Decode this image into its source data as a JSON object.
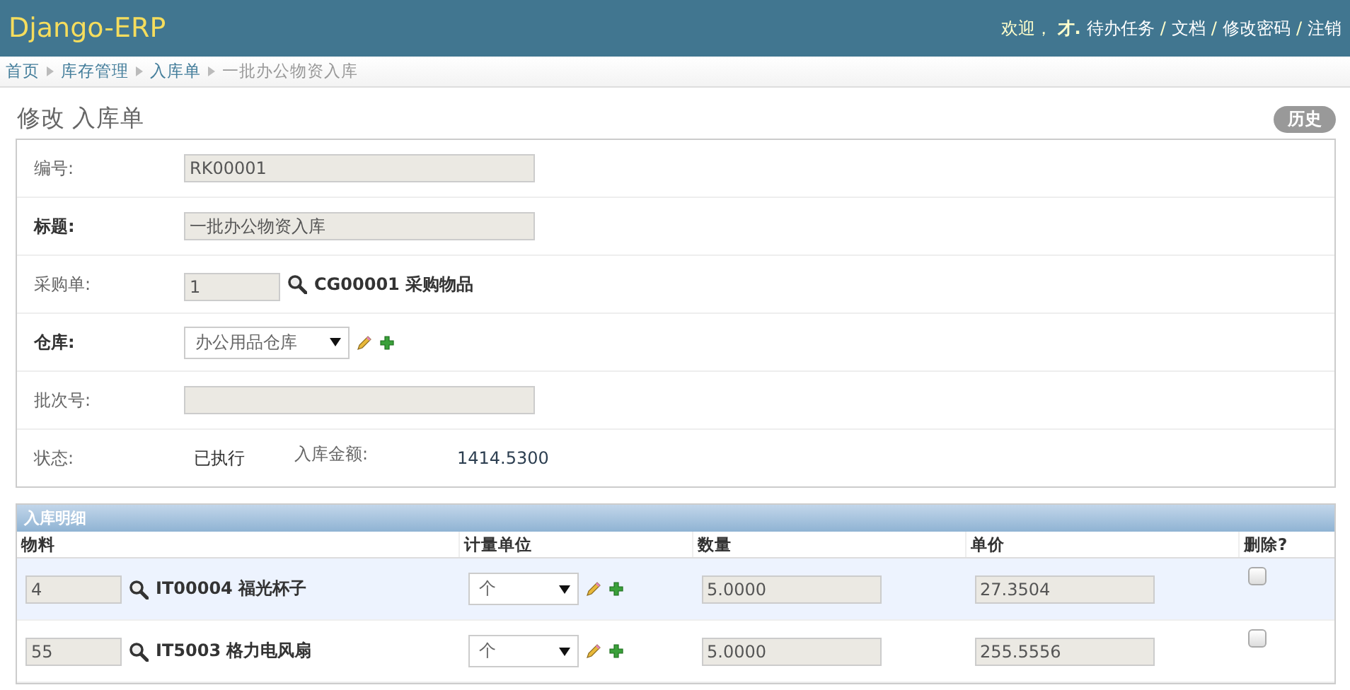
{
  "header": {
    "brand": "Django-ERP",
    "welcome": "欢迎，",
    "user": "才.",
    "links": [
      {
        "label": "待办任务"
      },
      {
        "separator": "/",
        "label": "文档"
      },
      {
        "separator": "/",
        "label": "修改密码"
      },
      {
        "separator": "/",
        "label": "注销"
      }
    ]
  },
  "breadcrumbs": [
    {
      "label": "首页",
      "link": true
    },
    {
      "label": "库存管理",
      "link": true
    },
    {
      "label": "入库单",
      "link": true
    },
    {
      "label": "一批办公物资入库",
      "link": false
    }
  ],
  "page_title": "修改 入库单",
  "history_button": "历史",
  "fields": [
    {
      "kind": "text",
      "label": "编号:",
      "bold": false,
      "value": "RK00001"
    },
    {
      "kind": "text",
      "label": "标题:",
      "bold": true,
      "value": "一批办公物资入库"
    },
    {
      "kind": "lookup",
      "label": "采购单:",
      "bold": false,
      "value": "1",
      "lookup_text": "CG00001 采购物品"
    },
    {
      "kind": "select",
      "label": "仓库:",
      "bold": true,
      "value": "办公用品仓库"
    },
    {
      "kind": "text",
      "label": "批次号:",
      "bold": false
    },
    {
      "kind": "readonly",
      "label": "状态:",
      "bold": false,
      "value": "已执行",
      "extra_label": "入库金额:",
      "extra_value": "1414.5300"
    }
  ],
  "inline": {
    "title": "入库明细",
    "columns": [
      "物料",
      "计量单位",
      "数量",
      "单价",
      "删除?"
    ],
    "rows": [
      {
        "item_id": "4",
        "item_text": "IT00004 福光杯子",
        "unit": "个",
        "quantity": "5.0000",
        "price": "27.3504",
        "delete": false
      },
      {
        "item_id": "55",
        "item_text": "IT5003 格力电风扇",
        "unit": "个",
        "quantity": "5.0000",
        "price": "255.5556",
        "delete": false
      }
    ]
  }
}
